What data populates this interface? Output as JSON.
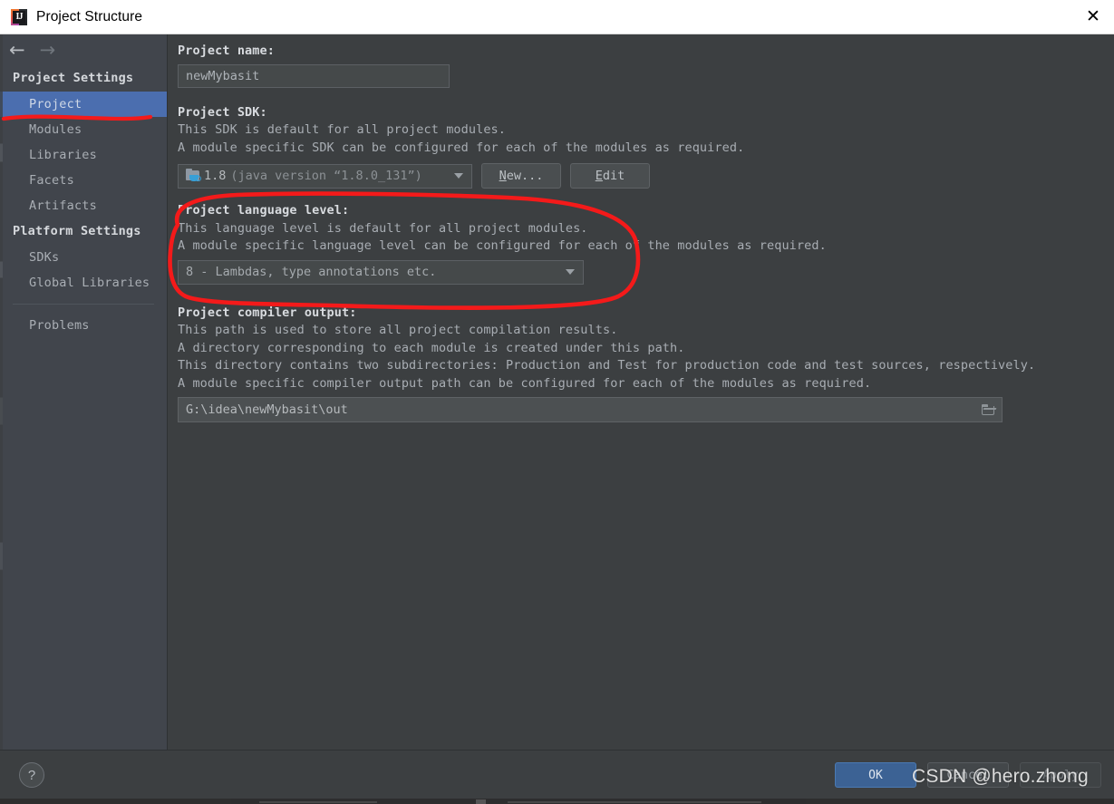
{
  "window": {
    "title": "Project Structure",
    "close_label": "✕",
    "app_icon": "intellij-idea-icon"
  },
  "nav": {
    "back": "←",
    "forward": "→"
  },
  "sidebar": {
    "groups": [
      {
        "title": "Project Settings",
        "items": [
          {
            "label": "Project",
            "selected": true
          },
          {
            "label": "Modules",
            "selected": false
          },
          {
            "label": "Libraries",
            "selected": false
          },
          {
            "label": "Facets",
            "selected": false
          },
          {
            "label": "Artifacts",
            "selected": false
          }
        ]
      },
      {
        "title": "Platform Settings",
        "items": [
          {
            "label": "SDKs",
            "selected": false
          },
          {
            "label": "Global Libraries",
            "selected": false
          }
        ]
      }
    ],
    "problems": "Problems"
  },
  "main": {
    "project_name": {
      "label": "Project name:",
      "value": "newMybasit"
    },
    "project_sdk": {
      "label": "Project SDK:",
      "desc_line1": "This SDK is default for all project modules.",
      "desc_line2": "A module specific SDK can be configured for each of the modules as required.",
      "selected_version": "1.8",
      "selected_detail": "(java version “1.8.0_131”)",
      "new_button_mnemonic": "N",
      "new_button_rest": "ew...",
      "edit_button_mnemonic": "E",
      "edit_button_rest": "dit"
    },
    "language_level": {
      "label": "Project language level:",
      "desc_line1": "This language level is default for all project modules.",
      "desc_line2": "A module specific language level can be configured for each of the modules as required.",
      "selected": "8 - Lambdas, type annotations etc."
    },
    "compiler_output": {
      "label": "Project compiler output:",
      "desc_line1": "This path is used to store all project compilation results.",
      "desc_line2": "A directory corresponding to each module is created under this path.",
      "desc_line3": "This directory contains two subdirectories: Production and Test for production code and test sources, respectively.",
      "desc_line4": "A module specific compiler output path can be configured for each of the modules as required.",
      "value": "G:\\idea\\newMybasit\\out",
      "browse_icon": "folder-browse-icon"
    }
  },
  "footer": {
    "help_label": "?",
    "ok_label": "OK",
    "cancel_label": "Cancel",
    "apply_label": "Apply"
  },
  "annotations": {
    "color": "#f41a1a",
    "underline_target": "Project",
    "circle_target": "Project language level"
  },
  "watermark": {
    "text": "CSDN @hero.zhong"
  }
}
